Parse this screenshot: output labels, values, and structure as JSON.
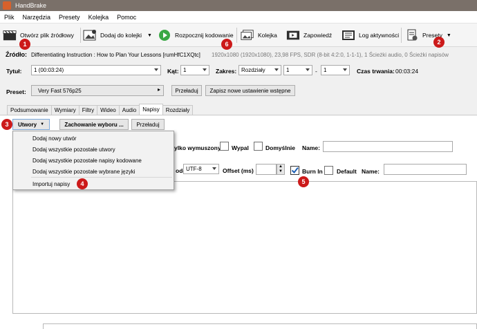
{
  "window": {
    "title": "HandBrake"
  },
  "menu": [
    "Plik",
    "Narzędzia",
    "Presety",
    "Kolejka",
    "Pomoc"
  ],
  "toolbar": {
    "open_source": "Otwórz plik źródłowy",
    "add_queue": "Dodaj do kolejki",
    "start": "Rozpocznij kodowanie",
    "queue": "Kolejka",
    "preview": "Zapowiedź",
    "activity": "Log aktywności",
    "presets": "Presety"
  },
  "source": {
    "label": "Źródło:",
    "name": "Differentiating Instruction :  How to Plan Your Lessons [rumHfC1XQtc]",
    "info": "1920x1080 (1920x1080), 23,98 FPS, SDR (8-bit 4:2:0, 1-1-1), 1 Ścieżki audio, 0 Ścieżki napisów"
  },
  "title_row": {
    "title_label": "Tytuł:",
    "title_value": "1  (00:03:24)",
    "angle_label": "Kąt:",
    "angle_value": "1",
    "range_label": "Zakres:",
    "range_type": "Rozdziały",
    "range_from": "1",
    "range_dash": "-",
    "range_to": "1",
    "duration_label": "Czas trwania:",
    "duration_value": "00:03:24"
  },
  "preset_row": {
    "label": "Preset:",
    "value": "Very Fast 576p25",
    "reload": "Przeładuj",
    "save_new": "Zapisz nowe ustawienie wstępne"
  },
  "tabs": [
    "Podsumowanie",
    "Wymiary",
    "Filtry",
    "Wideo",
    "Audio",
    "Napisy",
    "Rozdziały"
  ],
  "active_tab": "Napisy",
  "subtitles": {
    "tracks_button": "Utwory",
    "selection_behaviour": "Zachowanie wyboru ...",
    "reload": "Przeładuj",
    "forced_only": "ylko wymuszony",
    "burn": "Wypal",
    "default": "Domyślnie",
    "name_label": "Name:",
    "charcode_label": "ode",
    "charcode_value": "UTF-8",
    "offset_label": "Offset (ms)",
    "burn_in": "Burn In",
    "default2": "Default",
    "name_label2": "Name:"
  },
  "dropdown_menu": [
    "Dodaj nowy utwór",
    "Dodaj wszystkie pozostałe utwory",
    "Dodaj wszystkie pozostałe napisy kodowane",
    "Dodaj wszystkie pozostałe wybrane języki",
    "Importuj napisy"
  ],
  "badges": [
    "1",
    "2",
    "3",
    "4",
    "5",
    "6"
  ],
  "colors": {
    "badge": "#cc1a1a",
    "titlebar": "#7a7069",
    "start_green": "#3aa845",
    "check_blue": "#1c5fb5"
  }
}
